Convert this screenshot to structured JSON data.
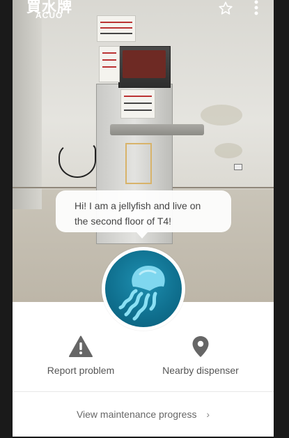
{
  "header": {
    "logo_main": "買水牌",
    "logo_sub": "ACUO",
    "favorite_icon": "star-outline-icon",
    "more_icon": "more-vertical-icon"
  },
  "speech_bubble": {
    "line1": "Hi! I am a jellyfish and live on",
    "line2": "the second floor of T4!"
  },
  "avatar": {
    "icon": "jellyfish-icon",
    "color": "#117496"
  },
  "actions": {
    "report": {
      "label": "Report problem",
      "icon": "warning-icon"
    },
    "nearby": {
      "label": "Nearby dispenser",
      "icon": "location-pin-icon"
    }
  },
  "maintenance": {
    "label": "View maintenance progress",
    "chevron": "›"
  },
  "colors": {
    "icon_gray": "#666666",
    "text_gray": "#555555"
  }
}
